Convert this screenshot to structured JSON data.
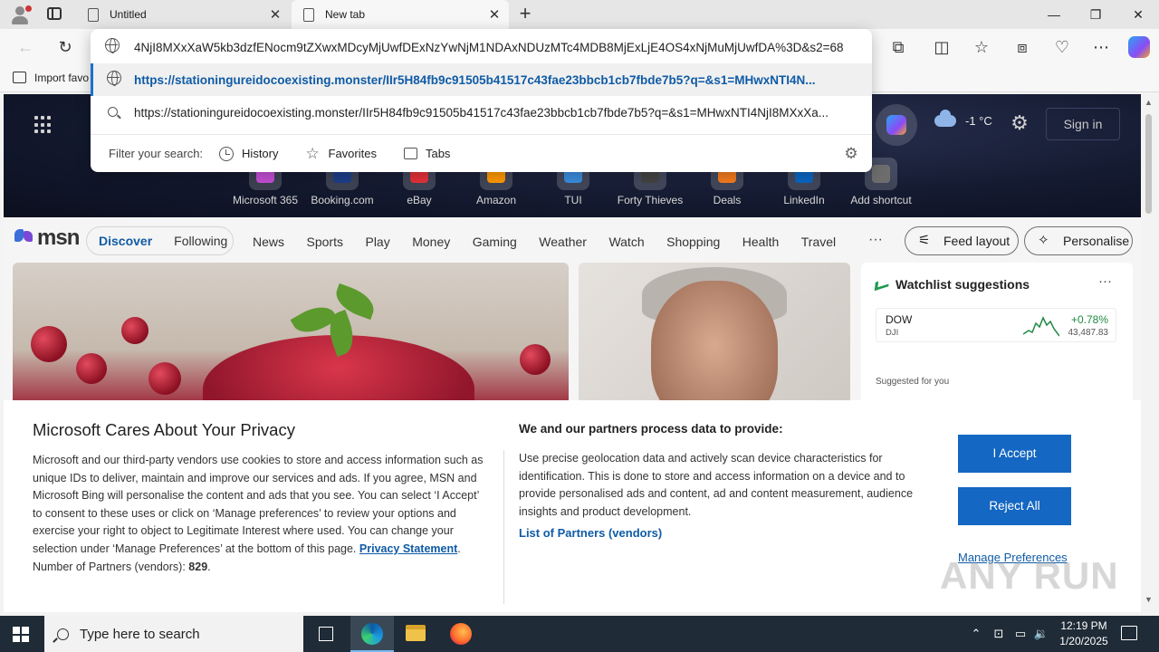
{
  "browser": {
    "tabs": [
      {
        "title": "Untitled",
        "active": false
      },
      {
        "title": "New tab",
        "active": true
      }
    ],
    "favorites_bar": {
      "import_label": "Import favo"
    }
  },
  "omnibox": {
    "suggestions": [
      {
        "icon": "globe-icon",
        "text": "4NjI8MXxXaW5kb3dzfENocm9tZXwxMDcyMjUwfDExNzYwNjM1NDAxNDUzMTc4MDB8MjExLjE4OS4xNjMuMjUwfDA%3D&s2=68",
        "selected": false
      },
      {
        "icon": "globe-icon",
        "text": "https://stationingureidocoexisting.monster/IIr5H84fb9c91505b41517c43fae23bbcb1cb7fbde7b5?q=&s1=MHwxNTI4N...",
        "selected": true
      },
      {
        "icon": "search-icon",
        "text": "https://stationingureidocoexisting.monster/IIr5H84fb9c91505b41517c43fae23bbcb1cb7fbde7b5?q=&s1=MHwxNTI4NjI8MXxXa...",
        "selected": false
      }
    ],
    "filter_label": "Filter your search:",
    "filters": [
      "History",
      "Favorites",
      "Tabs"
    ]
  },
  "hero": {
    "weather": "-1 °C",
    "signin": "Sign in",
    "shortcuts": [
      {
        "label": "Microsoft 365",
        "color": "#c54fd6"
      },
      {
        "label": "Booking.com",
        "color": "#1d3f8a"
      },
      {
        "label": "eBay",
        "color": "#e53238"
      },
      {
        "label": "Amazon",
        "color": "#ff9900"
      },
      {
        "label": "TUI",
        "color": "#3c8dde"
      },
      {
        "label": "Forty Thieves",
        "color": "#444444"
      },
      {
        "label": "Deals",
        "color": "#f57c1f"
      },
      {
        "label": "LinkedIn",
        "color": "#0a66c2"
      },
      {
        "label": "Add shortcut",
        "color": "#6d6d6d"
      }
    ]
  },
  "msn": {
    "logo": "msn",
    "pills": {
      "discover": "Discover",
      "following": "Following"
    },
    "nav": [
      "News",
      "Sports",
      "Play",
      "Money",
      "Gaming",
      "Weather",
      "Watch",
      "Shopping",
      "Health",
      "Travel"
    ],
    "more": "···",
    "feed_layout": "Feed layout",
    "personalise": "Personalise"
  },
  "watchlist": {
    "title": "Watchlist suggestions",
    "more": "···",
    "row": {
      "symbol": "DOW",
      "name": "DJI",
      "change": "+0.78%",
      "value": "43,487.83"
    },
    "suggested": "Suggested for you"
  },
  "privacy": {
    "title": "Microsoft Cares About Your Privacy",
    "body": "Microsoft and our third-party vendors use cookies to store and access information such as unique IDs to deliver, maintain and improve our services and ads. If you agree, MSN and Microsoft Bing will personalise the content and ads that you see. You can select ‘I Accept’ to consent to these uses or click on ‘Manage preferences’ to review your options and exercise your right to object to Legitimate Interest where used.  You can change your selection under ‘Manage Preferences’ at the bottom of this page.",
    "privacy_link": "Privacy Statement",
    "partners_label": "Number of Partners (vendors):",
    "partners_count": "829",
    "heading2": "We and our partners process data to provide:",
    "text2": "Use precise geolocation data and actively scan device characteristics for identification. This is done to store and access information on a device and to provide personalised ads and content, ad and content measurement, audience insights and product development.",
    "list_link": "List of Partners (vendors)",
    "accept": "I Accept",
    "reject": "Reject All",
    "manage": "Manage Preferences"
  },
  "watermark": "ANY RUN",
  "taskbar": {
    "search_placeholder": "Type here to search",
    "time": "12:19 PM",
    "date": "1/20/2025"
  }
}
